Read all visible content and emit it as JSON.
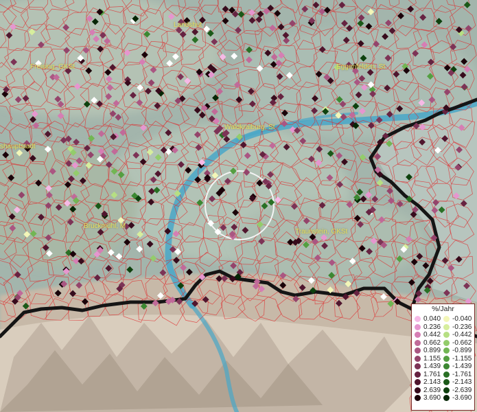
{
  "places": [
    {
      "id": "landshut",
      "label": "Landshut"
    },
    {
      "id": "freising",
      "label": "Freising, GKSt"
    },
    {
      "id": "eggenfelden",
      "label": "Eggenfelden, St"
    },
    {
      "id": "waldkraiburg",
      "label": "Waldkraiburg, St"
    },
    {
      "id": "hauptstadt",
      "label": "shauptstadt"
    },
    {
      "id": "bruckmuehl",
      "label": "Bruckmühl, M"
    },
    {
      "id": "traunstein",
      "label": "Traunstein, GKSt"
    }
  ],
  "legend": {
    "title": "%/Jahr",
    "positive": [
      {
        "label": "0.040",
        "color": "#f6b9e6"
      },
      {
        "label": "0.236",
        "color": "#e696cf"
      },
      {
        "label": "0.442",
        "color": "#d67eb4"
      },
      {
        "label": "0.662",
        "color": "#c16a99"
      },
      {
        "label": "0.899",
        "color": "#aa5682"
      },
      {
        "label": "1.155",
        "color": "#94446b"
      },
      {
        "label": "1.439",
        "color": "#7d3356"
      },
      {
        "label": "1.761",
        "color": "#662341"
      },
      {
        "label": "2.143",
        "color": "#50162e"
      },
      {
        "label": "2.639",
        "color": "#370b1c"
      },
      {
        "label": "3.690",
        "color": "#1a0209"
      }
    ],
    "negative": [
      {
        "label": "-0.040",
        "color": "#f3f6b8"
      },
      {
        "label": "-0.236",
        "color": "#d7ee9d"
      },
      {
        "label": "-0.442",
        "color": "#b6df83"
      },
      {
        "label": "-0.662",
        "color": "#93cc6b"
      },
      {
        "label": "-0.899",
        "color": "#72b654"
      },
      {
        "label": "-1.155",
        "color": "#549f41"
      },
      {
        "label": "-1.439",
        "color": "#3c8832"
      },
      {
        "label": "-1.761",
        "color": "#297025"
      },
      {
        "label": "-2.143",
        "color": "#1a5918"
      },
      {
        "label": "-2.639",
        "color": "#0e410e"
      },
      {
        "label": "-3.690",
        "color": "#052605"
      }
    ]
  }
}
